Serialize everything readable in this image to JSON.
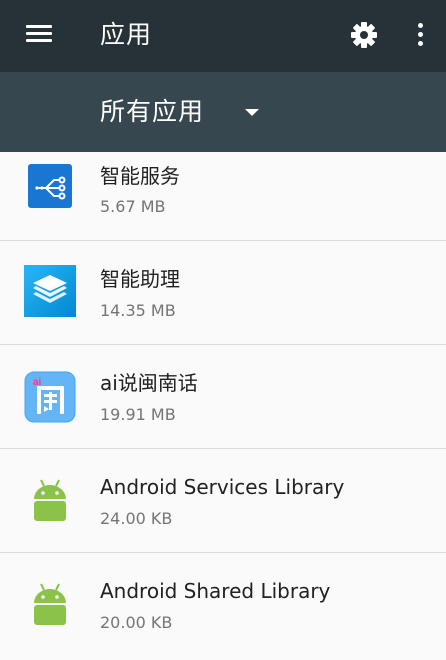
{
  "toolbar": {
    "title": "应用",
    "menu_icon": "hamburger-menu-icon",
    "settings_icon": "gear-icon",
    "more_icon": "more-vertical-icon",
    "background": "#263238"
  },
  "filter": {
    "selected": "所有应用",
    "icon": "dropdown-caret-icon",
    "background": "#37474f"
  },
  "apps": [
    {
      "name": "智能服务",
      "size": "5.67 MB",
      "icon": "share-nodes-icon"
    },
    {
      "name": "智能助理",
      "size": "14.35 MB",
      "icon": "layers-stack-icon"
    },
    {
      "name": "ai说闽南话",
      "size": "19.91 MB",
      "icon": "min-character-icon"
    },
    {
      "name": "Android Services Library",
      "size": "24.00 KB",
      "icon": "android-robot-icon"
    },
    {
      "name": "Android Shared Library",
      "size": "20.00 KB",
      "icon": "android-robot-icon"
    }
  ],
  "colors": {
    "android_green": "#8bc34a",
    "accent_blue": "#1976d2",
    "list_background": "#fafafa"
  }
}
